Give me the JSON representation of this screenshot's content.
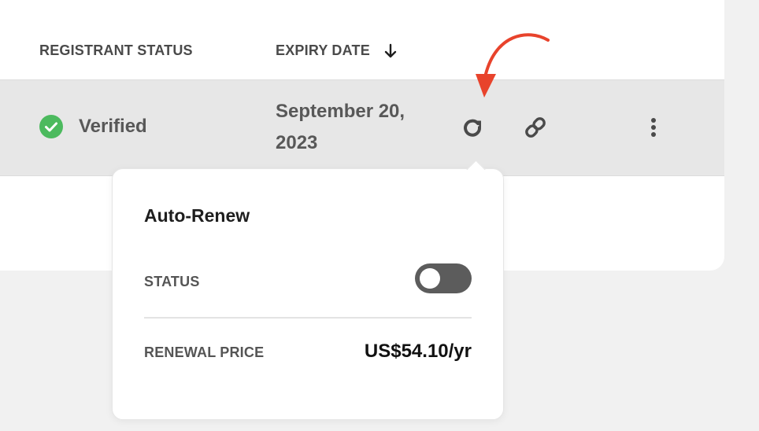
{
  "table": {
    "headers": {
      "registrant_status": "REGISTRANT STATUS",
      "expiry_date": "EXPIRY DATE"
    },
    "row": {
      "registrant_status": "Verified",
      "expiry_date": "September 20, 2023"
    }
  },
  "popover": {
    "title": "Auto-Renew",
    "status_label": "STATUS",
    "status_on": false,
    "renewal_price_label": "RENEWAL PRICE",
    "renewal_price": "US$54.10/yr"
  },
  "colors": {
    "verified": "#4cba5e",
    "annotation": "#e8432c",
    "toggle_off": "#5c5c5c"
  },
  "icons": {
    "sort": "arrow-down-icon",
    "status": "check-circle-icon",
    "renew": "refresh-icon",
    "link": "link-icon",
    "more": "more-vertical-icon"
  }
}
